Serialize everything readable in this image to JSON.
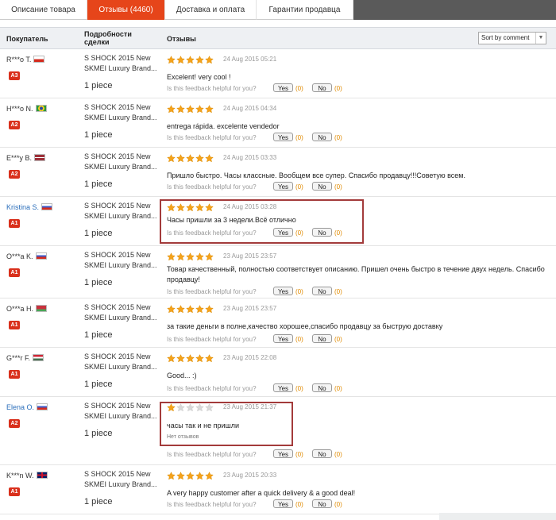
{
  "tabs": [
    {
      "label": "Описание товара"
    },
    {
      "label": "Отзывы (4460)"
    },
    {
      "label": "Доставка и оплата"
    },
    {
      "label": "Гарантии продавца"
    }
  ],
  "columns": {
    "buyer": "Покупатель",
    "details": "Подробности сделки",
    "reviews": "Отзывы"
  },
  "sort": {
    "label": "Sort by comment"
  },
  "helpful": {
    "question": "Is this feedback helpful for you?",
    "yes": "Yes",
    "no": "No",
    "count": "(0)"
  },
  "reviews": [
    {
      "buyer": "R***o T.",
      "flag": "Chile",
      "badge": "A3",
      "product": "S SHOCK 2015 New SKMEI Luxury Brand...",
      "qty": "1 piece",
      "rating": 5,
      "date": "24 Aug 2015 05:21",
      "comment": "Excelent! very cool !"
    },
    {
      "buyer": "H***o N.",
      "flag": "Brazil",
      "badge": "A2",
      "product": "S SHOCK 2015 New SKMEI Luxury Brand...",
      "qty": "1 piece",
      "rating": 5,
      "date": "24 Aug 2015 04:34",
      "comment": "entrega rápida. excelente vendedor"
    },
    {
      "buyer": "E***y B.",
      "flag": "Latvia",
      "badge": "A2",
      "product": "S SHOCK 2015 New SKMEI Luxury Brand...",
      "qty": "1 piece",
      "rating": 5,
      "date": "24 Aug 2015 03:33",
      "comment": "Пришло быстро. Часы классные. Вообщем все супер. Спасибо продавцу!!!Советую всем."
    },
    {
      "buyer": "Kristina S.",
      "flag": "Russia",
      "badge": "A1",
      "product": "S SHOCK 2015 New SKMEI Luxury Brand...",
      "qty": "1 piece",
      "rating": 5,
      "date": "24 Aug 2015 03:28",
      "comment": "Часы пришли за 3 недели.Всё отлично"
    },
    {
      "buyer": "O***a K.",
      "flag": "Russia",
      "badge": "A1",
      "product": "S SHOCK 2015 New SKMEI Luxury Brand...",
      "qty": "1 piece",
      "rating": 5,
      "date": "23 Aug 2015 23:57",
      "comment": "Товар качественный, полностью соответствует описанию. Пришел очень быстро в течение двух недель. Спасибо продавцу!"
    },
    {
      "buyer": "O***a H.",
      "flag": "Belarus",
      "badge": "A1",
      "product": "S SHOCK 2015 New SKMEI Luxury Brand...",
      "qty": "1 piece",
      "rating": 5,
      "date": "23 Aug 2015 23:57",
      "comment": "за такие деньги в полне,качество хорошее,спасибо продавцу за быструю доставку"
    },
    {
      "buyer": "G***r F.",
      "flag": "Hungary",
      "badge": "A1",
      "product": "S SHOCK 2015 New SKMEI Luxury Brand...",
      "qty": "1 piece",
      "rating": 5,
      "date": "23 Aug 2015 22:08",
      "comment": "Good... :)"
    },
    {
      "buyer": "Elena O.",
      "flag": "Russia",
      "badge": "A2",
      "product": "S SHOCK 2015 New SKMEI Luxury Brand...",
      "qty": "1 piece",
      "rating": 1,
      "date": "23 Aug 2015 21:37",
      "comment": "часы так и не пришли",
      "note": "Нет отзывов"
    },
    {
      "buyer": "K***n W.",
      "flag": "UK",
      "badge": "A1",
      "product": "S SHOCK 2015 New SKMEI Luxury Brand...",
      "qty": "1 piece",
      "rating": 5,
      "date": "23 Aug 2015 20:33",
      "comment": "A very happy customer after a quick delivery & a good deal!"
    }
  ],
  "colors": {
    "accent": "#e6451a",
    "badge": "#d9301c",
    "star": "#f5a21b",
    "highlight": "#a33b3b",
    "link": "#2a6ebb"
  }
}
